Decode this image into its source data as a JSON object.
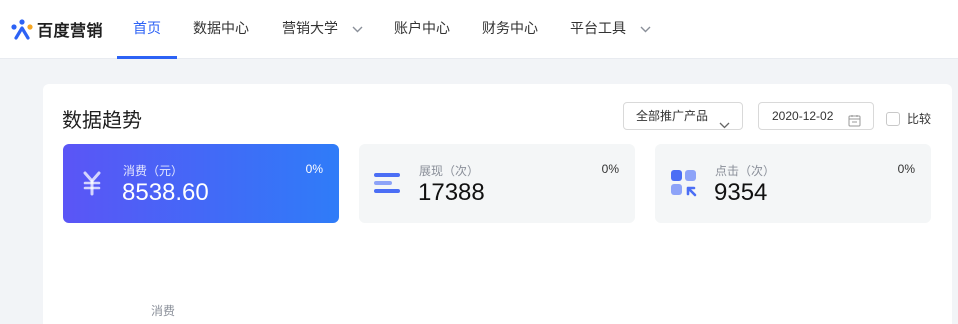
{
  "brand": {
    "name": "百度营销"
  },
  "nav": {
    "items": [
      {
        "label": "首页",
        "active": true
      },
      {
        "label": "数据中心"
      },
      {
        "label": "营销大学",
        "dropdown": true
      },
      {
        "label": "账户中心"
      },
      {
        "label": "财务中心"
      },
      {
        "label": "平台工具",
        "dropdown": true
      }
    ]
  },
  "trend": {
    "title": "数据趋势",
    "product_select": "全部推广产品",
    "date": "2020-12-02",
    "compare_label": "比较",
    "stats": [
      {
        "label": "消费（元）",
        "value": "8538.60",
        "change": "0%",
        "icon": "yuan-icon"
      },
      {
        "label": "展现（次）",
        "value": "17388",
        "change": "0%",
        "icon": "impressions-icon"
      },
      {
        "label": "点击（次）",
        "value": "9354",
        "change": "0%",
        "icon": "clicks-icon"
      }
    ],
    "chart_axis_label": "消费"
  },
  "colors": {
    "accent": "#2c62f5",
    "stat_gradient_start": "#5b55f6",
    "stat_gradient_end": "#2f7cf8"
  }
}
